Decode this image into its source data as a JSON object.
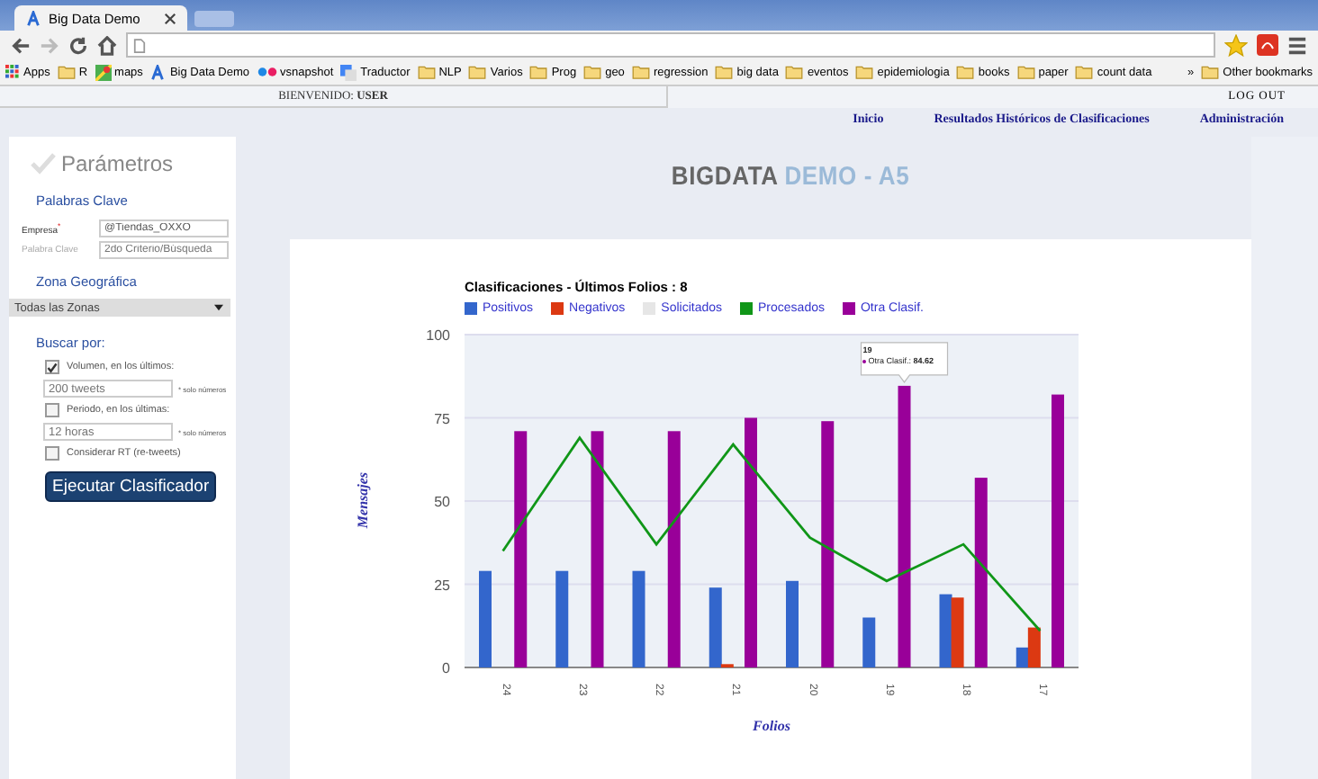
{
  "browser": {
    "tab_title": "Big Data Demo",
    "bookmarks": [
      {
        "kind": "apps",
        "label": "Apps"
      },
      {
        "kind": "folder",
        "label": "R"
      },
      {
        "kind": "maps",
        "label": "maps"
      },
      {
        "kind": "site",
        "label": "Big Data Demo"
      },
      {
        "kind": "dots",
        "label": "vsnapshot"
      },
      {
        "kind": "translate",
        "label": "Traductor"
      },
      {
        "kind": "folder",
        "label": "NLP"
      },
      {
        "kind": "folder",
        "label": "Varios"
      },
      {
        "kind": "folder",
        "label": "Prog"
      },
      {
        "kind": "folder",
        "label": "geo"
      },
      {
        "kind": "folder",
        "label": "regression"
      },
      {
        "kind": "folder",
        "label": "big data"
      },
      {
        "kind": "folder",
        "label": "eventos"
      },
      {
        "kind": "folder",
        "label": "epidemiologia"
      },
      {
        "kind": "folder",
        "label": "books"
      },
      {
        "kind": "folder",
        "label": "paper"
      },
      {
        "kind": "folder",
        "label": "count data"
      }
    ],
    "overflow": "»",
    "other_bookmarks": "Other bookmarks"
  },
  "header": {
    "welcome_label": "BIENVENIDO:",
    "user": "USER",
    "logout": "LOG OUT"
  },
  "nav": [
    {
      "label": "Inicio"
    },
    {
      "label": "Resultados Históricos de Clasificaciones"
    },
    {
      "label": "Administración"
    }
  ],
  "sidebar": {
    "title": "Parámetros",
    "keywords_heading": "Palabras Clave",
    "fields": [
      {
        "label": "Empresa",
        "required": true,
        "required_mark": "*",
        "value": "@Tiendas_OXXO"
      },
      {
        "label": "Palabra Clave",
        "required": false,
        "placeholder": "2do Criterio/Búsqueda"
      }
    ],
    "zone_heading": "Zona Geográfica",
    "zone_select": "Todas las Zonas",
    "search_heading": "Buscar por:",
    "options": [
      {
        "kind": "checkbox",
        "label": "Volumen, en los últimos:",
        "checked": true
      },
      {
        "kind": "input",
        "placeholder": "200 tweets",
        "hint": "* solo números"
      },
      {
        "kind": "checkbox",
        "label": "Periodo, en los últimas:",
        "checked": false
      },
      {
        "kind": "input",
        "placeholder": "12 horas",
        "hint": "* solo números"
      },
      {
        "kind": "checkbox",
        "label": "Considerar RT (re-tweets)",
        "checked": false
      }
    ],
    "button": "Ejecutar Clasificador"
  },
  "page_title": {
    "brand": "BIGDATA",
    "suffix": "DEMO - A5"
  },
  "chart_data": {
    "type": "bar",
    "title": "Clasificaciones - Últimos Folios : 8",
    "xlabel": "Folios",
    "ylabel": "Mensajes",
    "categories": [
      "24",
      "23",
      "22",
      "21",
      "20",
      "19",
      "18",
      "17"
    ],
    "series": [
      {
        "name": "Positivos",
        "color": "#3366cc",
        "type": "bar",
        "values": [
          29,
          29,
          29,
          24,
          26,
          15,
          22,
          6
        ]
      },
      {
        "name": "Negativos",
        "color": "#dc3912",
        "type": "bar",
        "values": [
          0,
          0,
          0,
          1,
          0,
          0,
          21,
          12
        ]
      },
      {
        "name": "Solicitados",
        "color": "#e6e6e6",
        "type": "bar",
        "values": [
          null,
          null,
          null,
          null,
          null,
          null,
          null,
          null
        ]
      },
      {
        "name": "Procesados",
        "color": "#109618",
        "type": "line",
        "values": [
          35,
          69,
          37,
          67,
          39,
          26,
          37,
          11
        ]
      },
      {
        "name": "Otra Clasif.",
        "color": "#990099",
        "type": "bar",
        "values": [
          71,
          71,
          71,
          75,
          74,
          84.62,
          57,
          82
        ]
      }
    ],
    "ylim": [
      0,
      100
    ],
    "yticks": [
      0,
      25,
      50,
      75,
      100
    ],
    "grid": true,
    "annotations": [
      "19",
      "Otra Clasif.: **84.62**"
    ]
  }
}
